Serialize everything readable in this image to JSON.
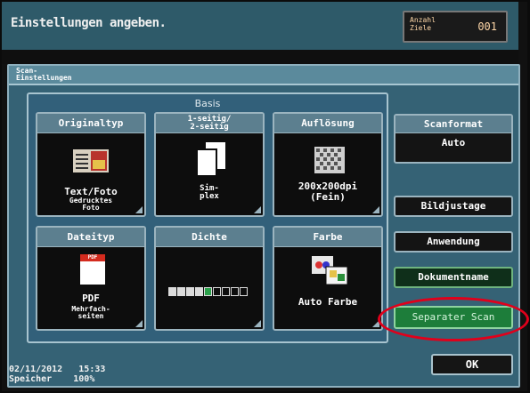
{
  "header": {
    "message": "Einstellungen angeben.",
    "count_label": "Anzahl\nZiele",
    "count_value": "001"
  },
  "panel": {
    "title": "Scan-\nEinstellungen",
    "basis_label": "Basis"
  },
  "tiles": {
    "originaltyp": {
      "title": "Originaltyp",
      "value": "Text/Foto",
      "sub": "Gedrucktes\nFoto"
    },
    "duplex": {
      "title": "1-seitig/\n2-seitig",
      "value": "Sim-\nplex"
    },
    "aufloesung": {
      "title": "Auflösung",
      "value": "200x200dpi\n(Fein)"
    },
    "dateityp": {
      "title": "Dateityp",
      "value": "PDF",
      "sub": "Mehrfach-\nseiten",
      "badge": "PDF"
    },
    "dichte": {
      "title": "Dichte",
      "level": 5,
      "segments": 9
    },
    "farbe": {
      "title": "Farbe",
      "value": "Auto Farbe"
    }
  },
  "side": {
    "scanformat_title": "Scanformat",
    "scanformat_value": "Auto",
    "bildjustage": "Bildjustage",
    "anwendung": "Anwendung",
    "dokumentname": "Dokumentname",
    "separater_scan": "Separater Scan",
    "ok": "OK"
  },
  "status": {
    "date": "02/11/2012",
    "time": "15:33",
    "memory_label": "Speicher",
    "memory_value": "100%"
  },
  "colors": {
    "header_bg": "#2e5a69",
    "panel_bg": "#356275",
    "highlight_green": "#1d7d3a",
    "annotation_red": "#e0001b"
  }
}
